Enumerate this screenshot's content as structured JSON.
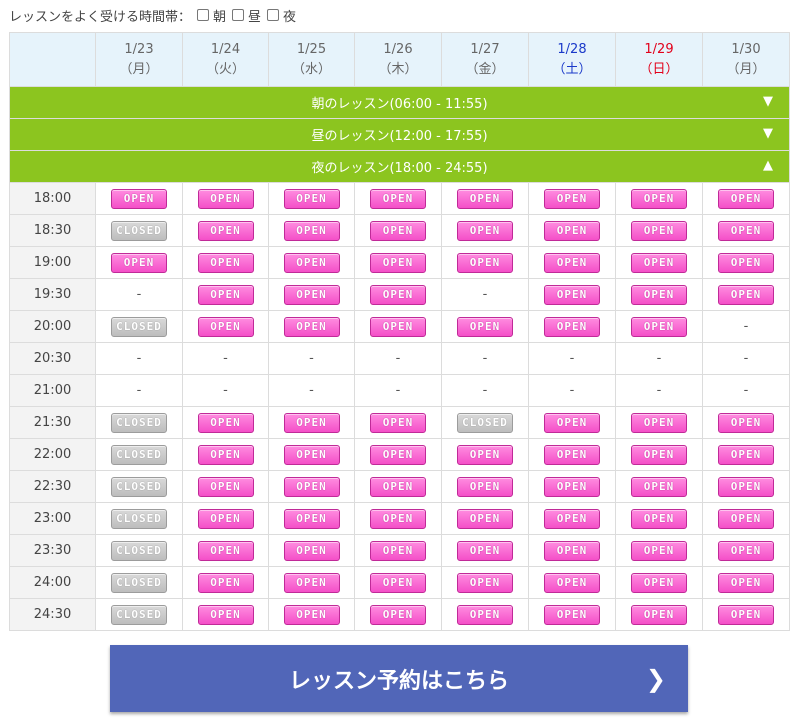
{
  "filter": {
    "label": "レッスンをよく受ける時間帯：",
    "options": [
      "朝",
      "昼",
      "夜"
    ]
  },
  "dates": [
    {
      "date": "1/23",
      "dow": "（月）",
      "kind": "weekday"
    },
    {
      "date": "1/24",
      "dow": "（火）",
      "kind": "weekday"
    },
    {
      "date": "1/25",
      "dow": "（水）",
      "kind": "weekday"
    },
    {
      "date": "1/26",
      "dow": "（木）",
      "kind": "weekday"
    },
    {
      "date": "1/27",
      "dow": "（金）",
      "kind": "weekday"
    },
    {
      "date": "1/28",
      "dow": "（土）",
      "kind": "sat"
    },
    {
      "date": "1/29",
      "dow": "（日）",
      "kind": "sun"
    },
    {
      "date": "1/30",
      "dow": "（月）",
      "kind": "weekday"
    }
  ],
  "bands": [
    {
      "label": "朝のレッスン(06:00 - 11:55)",
      "arrow": "▼"
    },
    {
      "label": "昼のレッスン(12:00 - 17:55)",
      "arrow": "▼"
    },
    {
      "label": "夜のレッスン(18:00 - 24:55)",
      "arrow": "▲"
    }
  ],
  "status_labels": {
    "O": "OPEN",
    "C": "CLOSED",
    "-": "-"
  },
  "slots": [
    {
      "time": "18:00",
      "cells": [
        "O",
        "O",
        "O",
        "O",
        "O",
        "O",
        "O",
        "O"
      ]
    },
    {
      "time": "18:30",
      "cells": [
        "C",
        "O",
        "O",
        "O",
        "O",
        "O",
        "O",
        "O"
      ]
    },
    {
      "time": "19:00",
      "cells": [
        "O",
        "O",
        "O",
        "O",
        "O",
        "O",
        "O",
        "O"
      ]
    },
    {
      "time": "19:30",
      "cells": [
        "-",
        "O",
        "O",
        "O",
        "-",
        "O",
        "O",
        "O"
      ]
    },
    {
      "time": "20:00",
      "cells": [
        "C",
        "O",
        "O",
        "O",
        "O",
        "O",
        "O",
        "-"
      ]
    },
    {
      "time": "20:30",
      "cells": [
        "-",
        "-",
        "-",
        "-",
        "-",
        "-",
        "-",
        "-"
      ]
    },
    {
      "time": "21:00",
      "cells": [
        "-",
        "-",
        "-",
        "-",
        "-",
        "-",
        "-",
        "-"
      ]
    },
    {
      "time": "21:30",
      "cells": [
        "C",
        "O",
        "O",
        "O",
        "C",
        "O",
        "O",
        "O"
      ]
    },
    {
      "time": "22:00",
      "cells": [
        "C",
        "O",
        "O",
        "O",
        "O",
        "O",
        "O",
        "O"
      ]
    },
    {
      "time": "22:30",
      "cells": [
        "C",
        "O",
        "O",
        "O",
        "O",
        "O",
        "O",
        "O"
      ]
    },
    {
      "time": "23:00",
      "cells": [
        "C",
        "O",
        "O",
        "O",
        "O",
        "O",
        "O",
        "O"
      ]
    },
    {
      "time": "23:30",
      "cells": [
        "C",
        "O",
        "O",
        "O",
        "O",
        "O",
        "O",
        "O"
      ]
    },
    {
      "time": "24:00",
      "cells": [
        "C",
        "O",
        "O",
        "O",
        "O",
        "O",
        "O",
        "O"
      ]
    },
    {
      "time": "24:30",
      "cells": [
        "C",
        "O",
        "O",
        "O",
        "O",
        "O",
        "O",
        "O"
      ]
    }
  ],
  "cta": {
    "label": "レッスン予約はこちら",
    "icon": "chevron-right-icon"
  },
  "colors": {
    "band": "#8cc51f",
    "header": "#e6f3fb",
    "cta": "#5166b8",
    "sat": "#1a39c9",
    "sun": "#e2001a",
    "open": "#f44fc8",
    "closed": "#bdbdbd"
  }
}
